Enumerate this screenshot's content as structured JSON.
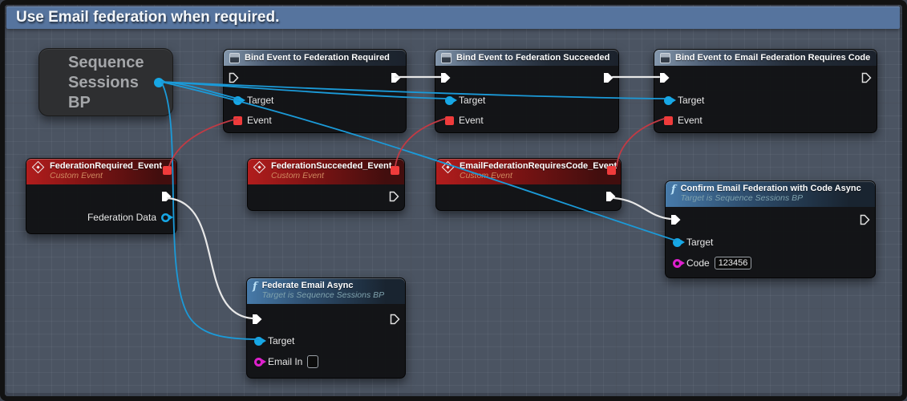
{
  "comment": {
    "title": "Use Email federation when required."
  },
  "graph": {
    "variable_node": {
      "title": "Sequence\nSessions\nBP"
    },
    "bind_required": {
      "title": "Bind Event to Federation Required",
      "target_label": "Target",
      "event_label": "Event"
    },
    "bind_succeeded": {
      "title": "Bind Event to Federation Succeeded",
      "target_label": "Target",
      "event_label": "Event"
    },
    "bind_requires_code": {
      "title": "Bind Event to Email Federation Requires Code",
      "target_label": "Target",
      "event_label": "Event"
    },
    "event_required": {
      "title": "FederationRequired_Event",
      "subtitle": "Custom Event",
      "data_pin_label": "Federation Data"
    },
    "event_succeeded": {
      "title": "FederationSucceeded_Event",
      "subtitle": "Custom Event"
    },
    "event_requires_code": {
      "title": "EmailFederationRequiresCode_Event",
      "subtitle": "Custom Event"
    },
    "fn_confirm": {
      "title": "Confirm Email Federation with Code Async",
      "subtitle": "Target is Sequence Sessions BP",
      "target_label": "Target",
      "code_label": "Code",
      "code_value": "123456"
    },
    "fn_federate": {
      "title": "Federate Email Async",
      "subtitle": "Target is Sequence Sessions BP",
      "target_label": "Target",
      "email_label": "Email In",
      "email_value": ""
    }
  },
  "colors": {
    "comment_bar": "#56749e",
    "exec_wire": "#e8e8e8",
    "object_pin": "#17a7e5",
    "delegate_pin": "#ef3b3b",
    "string_pin": "#dd20cc",
    "event_header_red": "#b11d1d",
    "function_header_blue": "#477aa9",
    "grid_background": "#3d4451"
  }
}
